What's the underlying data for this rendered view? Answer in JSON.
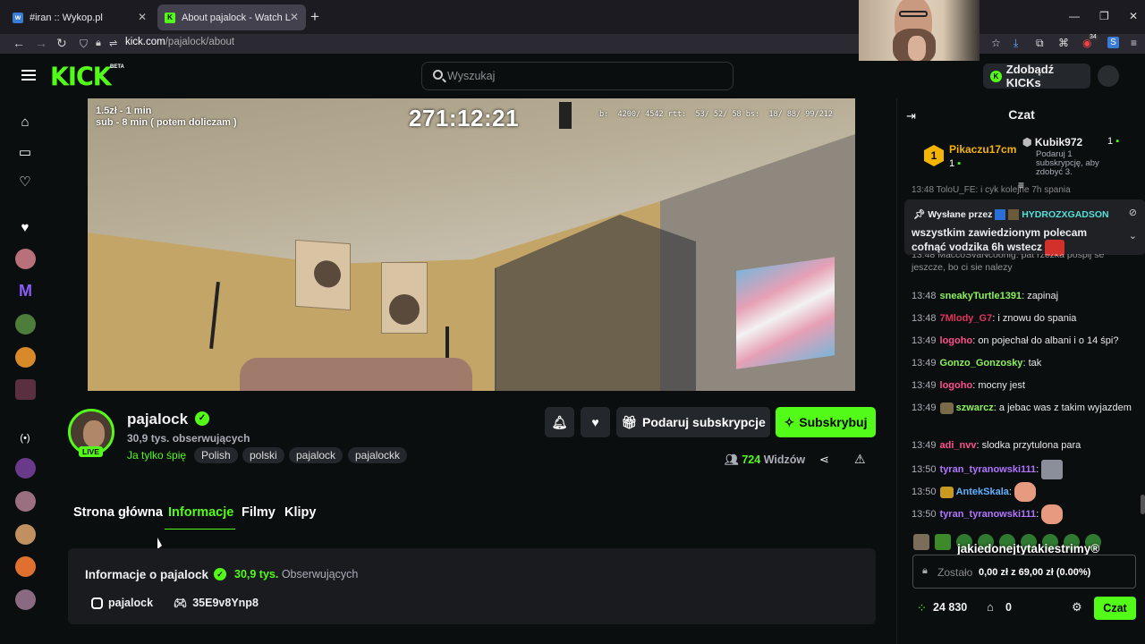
{
  "browser": {
    "tabs": [
      {
        "title": "#iran :: Wykop.pl",
        "active": false
      },
      {
        "title": "About pajalock - Watch Live on",
        "active": true
      }
    ],
    "url_host": "kick.com",
    "url_path": "/pajalock/about",
    "extension_badge": "34"
  },
  "header": {
    "logo": "KICK",
    "logo_badge": "BETA",
    "search_placeholder": "Wyszukaj",
    "kicks_button": "Zdobądź KICKs"
  },
  "stream": {
    "overlay_line1": "1.5zł - 1 min",
    "overlay_line2": "sub - 8 min ( potem doliczam )",
    "timer": "271:12:21",
    "stats_text": "b:  4200/ 4542 rtt:  53/ 52/ 58 bs:  18/ 88/ 99/212"
  },
  "channel": {
    "name": "pajalock",
    "followers": "30,9 tys. obserwujących",
    "live_badge": "LIVE",
    "category": "Ja tylko śpię",
    "tags": [
      "Polish",
      "polski",
      "pajalock",
      "pajalockk"
    ],
    "viewers_count": "724",
    "viewers_label": "Widzów",
    "gift_sub_label": "Podaruj subskrypcje",
    "subscribe_label": "Subskrybuj"
  },
  "page_tabs": [
    "Strona główna",
    "Informacje",
    "Filmy",
    "Klipy"
  ],
  "about": {
    "title": "Informacje o pajalock",
    "followers_count": "30,9 tys.",
    "followers_label": "Obserwujących",
    "instagram": "pajalock",
    "discord": "35E9v8Ynp8"
  },
  "chat": {
    "title": "Czat",
    "leaderboard": [
      {
        "name": "Pikaczu17cm",
        "count": "1",
        "rank": "1"
      },
      {
        "name": "Kubik972",
        "count": "1",
        "note": "Podaruj 1 subskrypcję, aby zdobyć 3."
      }
    ],
    "pinned_by_label": "Wysłane przez",
    "pinned_by_user": "HYDROZXGADSON",
    "pinned_text": "wszystkim zawiedzionym polecam cofnąć vodzika 6h wstecz",
    "partial_top": "13:48 ToloU_FE: i cyk kolejne 7h spania",
    "partial_second_a": "13:48 MaccoSvaNcoonig: pat rzezka pospij se",
    "partial_second_b": "jeszcze, bo ci sie nalezy",
    "messages": [
      {
        "time": "13:48",
        "user": "sneakyTurtle1391",
        "color": "#8cf25a",
        "text": "zapinaj"
      },
      {
        "time": "13:48",
        "user": "7Mlody_G7",
        "color": "#e3335c",
        "text": "i znowu do spania"
      },
      {
        "time": "13:49",
        "user": "logoho",
        "color": "#ff4f8a",
        "text": "on pojechał do albani i o 14 śpi?"
      },
      {
        "time": "13:49",
        "user": "Gonzo_Gonzosky",
        "color": "#8cf25a",
        "text": "tak"
      },
      {
        "time": "13:49",
        "user": "logoho",
        "color": "#ff4f8a",
        "text": "mocny jest"
      },
      {
        "time": "13:49",
        "user": "szwarcz",
        "color": "#8cf25a",
        "text": "a jebac was z takim wyjazdem"
      },
      {
        "time": "13:49",
        "user": "adi_nvv",
        "color": "#ff4f8a",
        "text": "slodka przytulona para"
      },
      {
        "time": "13:50",
        "user": "tyran_tyranowski111",
        "color": "#b273ff",
        "text": ""
      },
      {
        "time": "13:50",
        "user": "AntekSkala",
        "color": "#5fb2ff",
        "text": ""
      },
      {
        "time": "13:50",
        "user": "tyran_tyranowski111",
        "color": "#b273ff",
        "text": ""
      }
    ],
    "goal_title": "jakiedonejtytakiestrimy®",
    "goal_prefix": "Zostało",
    "goal_amount": "0,00 zł z 69,00 zł (0.00%)",
    "goal_progress": 0,
    "points": "24 830",
    "store_count": "0",
    "send_label": "Czat"
  }
}
